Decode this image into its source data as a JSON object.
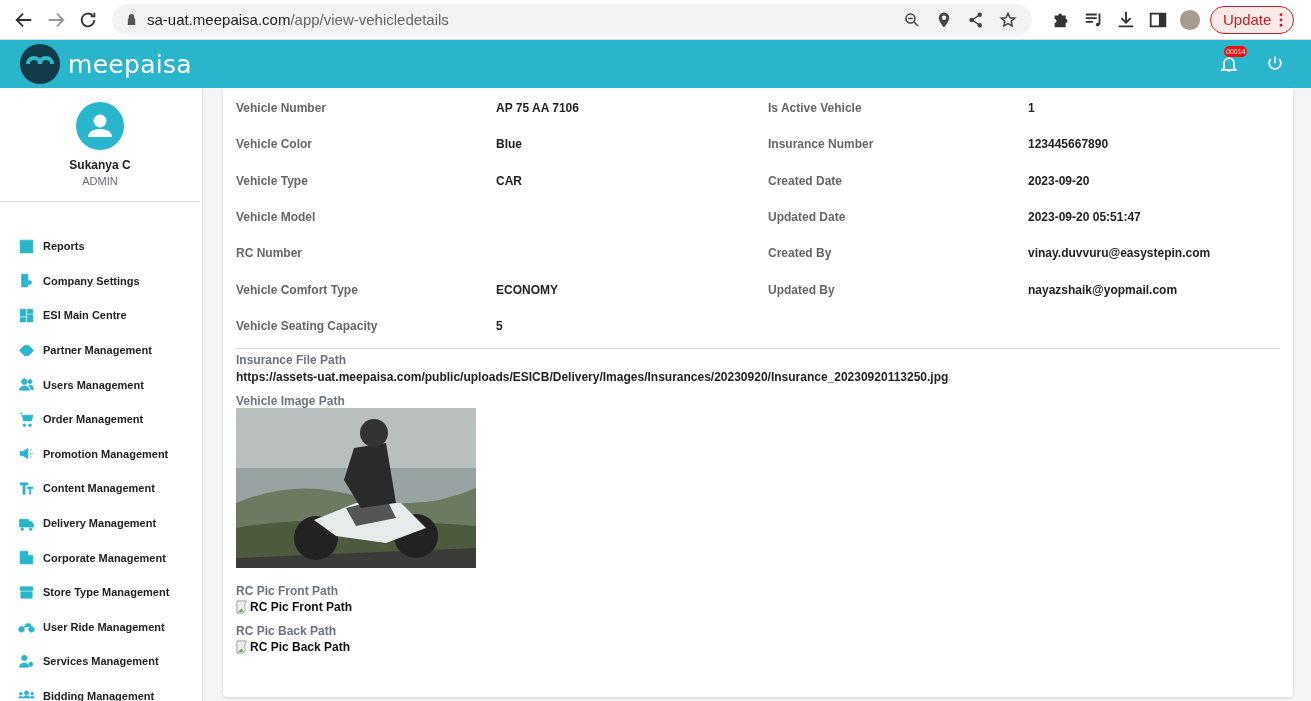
{
  "browser": {
    "url_host": "sa-uat.meepaisa.com",
    "url_path": "/app/view-vehicledetails",
    "update_button": "Update"
  },
  "header": {
    "logo_text": "meepaisa",
    "notification_count": "00014"
  },
  "user": {
    "name": "Sukanya C",
    "role": "ADMIN"
  },
  "sidebar": {
    "items": [
      {
        "label": "Reports"
      },
      {
        "label": "Company Settings"
      },
      {
        "label": "ESI Main Centre"
      },
      {
        "label": "Partner Management"
      },
      {
        "label": "Users Management"
      },
      {
        "label": "Order Management"
      },
      {
        "label": "Promotion Management"
      },
      {
        "label": "Content Management"
      },
      {
        "label": "Delivery Management"
      },
      {
        "label": "Corporate Management"
      },
      {
        "label": "Store Type Management"
      },
      {
        "label": "User Ride Management"
      },
      {
        "label": "Services Management"
      },
      {
        "label": "Bidding Management"
      }
    ]
  },
  "details": {
    "rows": [
      {
        "left": {
          "label": "Vehicle Number",
          "value": "AP 75 AA 7106"
        },
        "right": {
          "label": "Is Active Vehicle",
          "value": "1"
        }
      },
      {
        "left": {
          "label": "Vehicle Color",
          "value": "Blue"
        },
        "right": {
          "label": "Insurance Number",
          "value": "123445667890"
        }
      },
      {
        "left": {
          "label": "Vehicle Type",
          "value": "CAR"
        },
        "right": {
          "label": "Created Date",
          "value": "2023-09-20"
        }
      },
      {
        "left": {
          "label": "Vehicle Model"
        },
        "right": {
          "label": "Updated Date",
          "value": "2023-09-20 05:51:47"
        }
      },
      {
        "left": {
          "label": "RC Number"
        },
        "right": {
          "label": "Created By",
          "value": "vinay.duvvuru@easystepin.com"
        }
      },
      {
        "left": {
          "label": "Vehicle Comfort Type",
          "value": "ECONOMY"
        },
        "right": {
          "label": "Updated By",
          "value": "nayazshaik@yopmail.com"
        }
      },
      {
        "left": {
          "label": "Vehicle Seating Capacity",
          "value": "5"
        }
      }
    ]
  },
  "insurance_file": {
    "label": "Insurance File Path",
    "value": "https://assets-uat.meepaisa.com/public/uploads/ESICB/Delivery/Images/Insurances/20230920/Insurance_20230920113250.jpg"
  },
  "vehicle_image": {
    "label": "Vehicle Image Path",
    "kind": "picture"
  },
  "rc_pics": [
    {
      "label": "RC Pic Front Path",
      "alt": "RC Pic Front Path"
    },
    {
      "label": "RC Pic Back Path",
      "alt": "RC Pic Back Path"
    }
  ]
}
